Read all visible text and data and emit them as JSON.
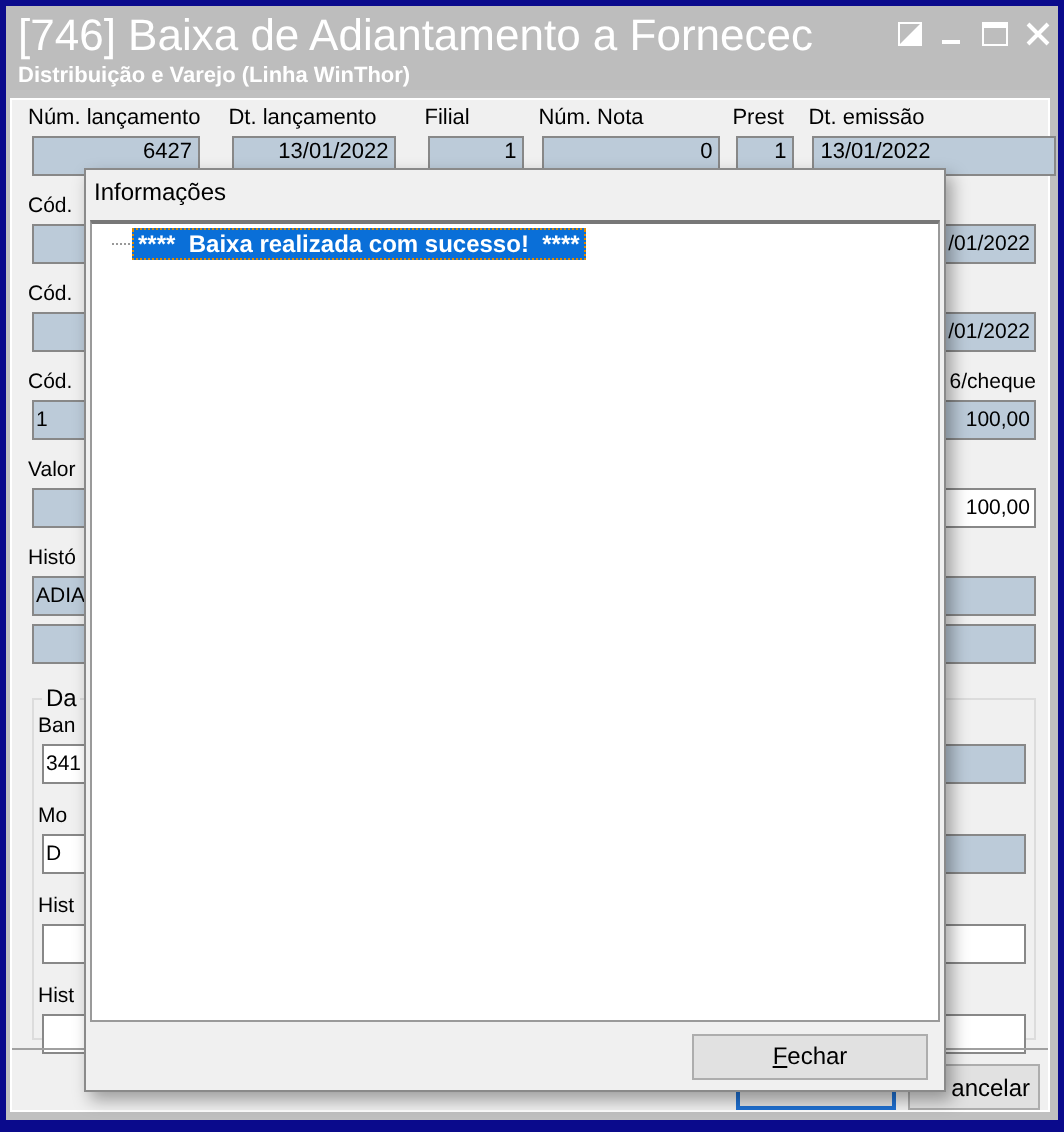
{
  "window": {
    "title": "[746] Baixa de Adiantamento a Fornecec",
    "subtitle": "Distribuição e Varejo (Linha WinThor)"
  },
  "header_fields": [
    {
      "label": "Núm. lançamento",
      "value": "6427"
    },
    {
      "label": "Dt. lançamento",
      "value": "13/01/2022"
    },
    {
      "label": "Filial",
      "value": "1"
    },
    {
      "label": "Núm. Nota",
      "value": "0"
    },
    {
      "label": "Prest",
      "value": "1"
    },
    {
      "label": "Dt. emissão",
      "value": "13/01/2022"
    }
  ],
  "form_rows": [
    {
      "label": "Cód.",
      "segments": [
        {
          "readonly": true
        },
        {
          "readonly": true,
          "value": "/01/2022"
        }
      ]
    },
    {
      "label": "Cód.",
      "segments": [
        {
          "readonly": true
        },
        {
          "readonly": true,
          "value": "/01/2022"
        }
      ]
    },
    {
      "label": "Cód.",
      "right_label": "6/cheque",
      "segments": [
        {
          "readonly": true,
          "value": "1"
        },
        {
          "readonly": true,
          "value": "100,00"
        }
      ]
    },
    {
      "label": "Valor",
      "segments": [
        {
          "readonly": true
        },
        {
          "readonly": false,
          "value": "100,00"
        }
      ]
    },
    {
      "label": "Histó",
      "segments": [
        {
          "readonly": true,
          "value": "ADIA"
        },
        {
          "readonly": true
        }
      ]
    },
    {
      "segments": [
        {
          "readonly": true
        },
        {
          "readonly": true
        }
      ]
    }
  ],
  "group": {
    "legend": "Da",
    "rows": [
      {
        "label": "Ban",
        "segments": [
          {
            "readonly": false,
            "value": "341"
          },
          {
            "readonly": true
          }
        ]
      },
      {
        "label": "Mo",
        "segments": [
          {
            "readonly": false,
            "value": "D"
          },
          {
            "readonly": true
          }
        ]
      },
      {
        "label": "Hist",
        "segments": [
          {
            "readonly": false
          },
          {
            "readonly": false
          }
        ]
      },
      {
        "label": "Hist",
        "segments": [
          {
            "readonly": false
          },
          {
            "readonly": false
          }
        ]
      }
    ]
  },
  "bottom_buttons": [
    {
      "focused": true
    },
    {
      "label": "ancelar",
      "focused": false
    }
  ],
  "dialog": {
    "title": "Informações",
    "items": [
      {
        "text": "****  Baixa realizada com sucesso!  ****",
        "selected": true
      }
    ],
    "button": "Fechar"
  }
}
